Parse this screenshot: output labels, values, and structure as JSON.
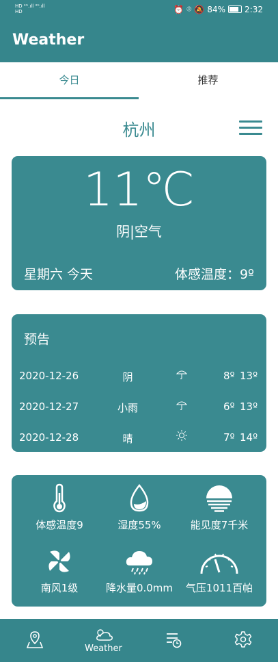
{
  "statusbar": {
    "network": "HD 4G 4G",
    "battery": "84%",
    "time": "2:32"
  },
  "appbar": {
    "title": "Weather"
  },
  "tabs": [
    {
      "label": "今日"
    },
    {
      "label": "推荐"
    }
  ],
  "city": "杭州",
  "current": {
    "temp": "11℃",
    "condition": "阴|空气",
    "day": "星期六  今天",
    "feels_like": "体感温度：9º"
  },
  "forecast": {
    "title": "预告",
    "rows": [
      {
        "date": "2020-12-26",
        "weather": "阴",
        "icon": "umbrella-icon",
        "low": "8º",
        "high": "13º"
      },
      {
        "date": "2020-12-27",
        "weather": "小雨",
        "icon": "umbrella-icon",
        "low": "6º",
        "high": "13º"
      },
      {
        "date": "2020-12-28",
        "weather": "晴",
        "icon": "sun-icon",
        "low": "7º",
        "high": "14º"
      }
    ]
  },
  "details": [
    {
      "label": "体感温度9",
      "icon": "thermometer-icon"
    },
    {
      "label": "湿度55%",
      "icon": "humidity-drop-icon"
    },
    {
      "label": "能见度7千米",
      "icon": "visibility-icon"
    },
    {
      "label": "南风1级",
      "icon": "wind-fan-icon"
    },
    {
      "label": "降水量0.0mm",
      "icon": "rain-cloud-icon"
    },
    {
      "label": "气压1011百帕",
      "icon": "pressure-gauge-icon"
    }
  ],
  "bottomnav": [
    {
      "label": "",
      "icon": "location-icon"
    },
    {
      "label": "Weather",
      "icon": "weather-icon"
    },
    {
      "label": "",
      "icon": "schedule-list-icon"
    },
    {
      "label": "",
      "icon": "settings-gear-icon"
    }
  ],
  "colors": {
    "primary": "#3a8a90",
    "appbar": "#36868c",
    "background": "#ffffff"
  }
}
